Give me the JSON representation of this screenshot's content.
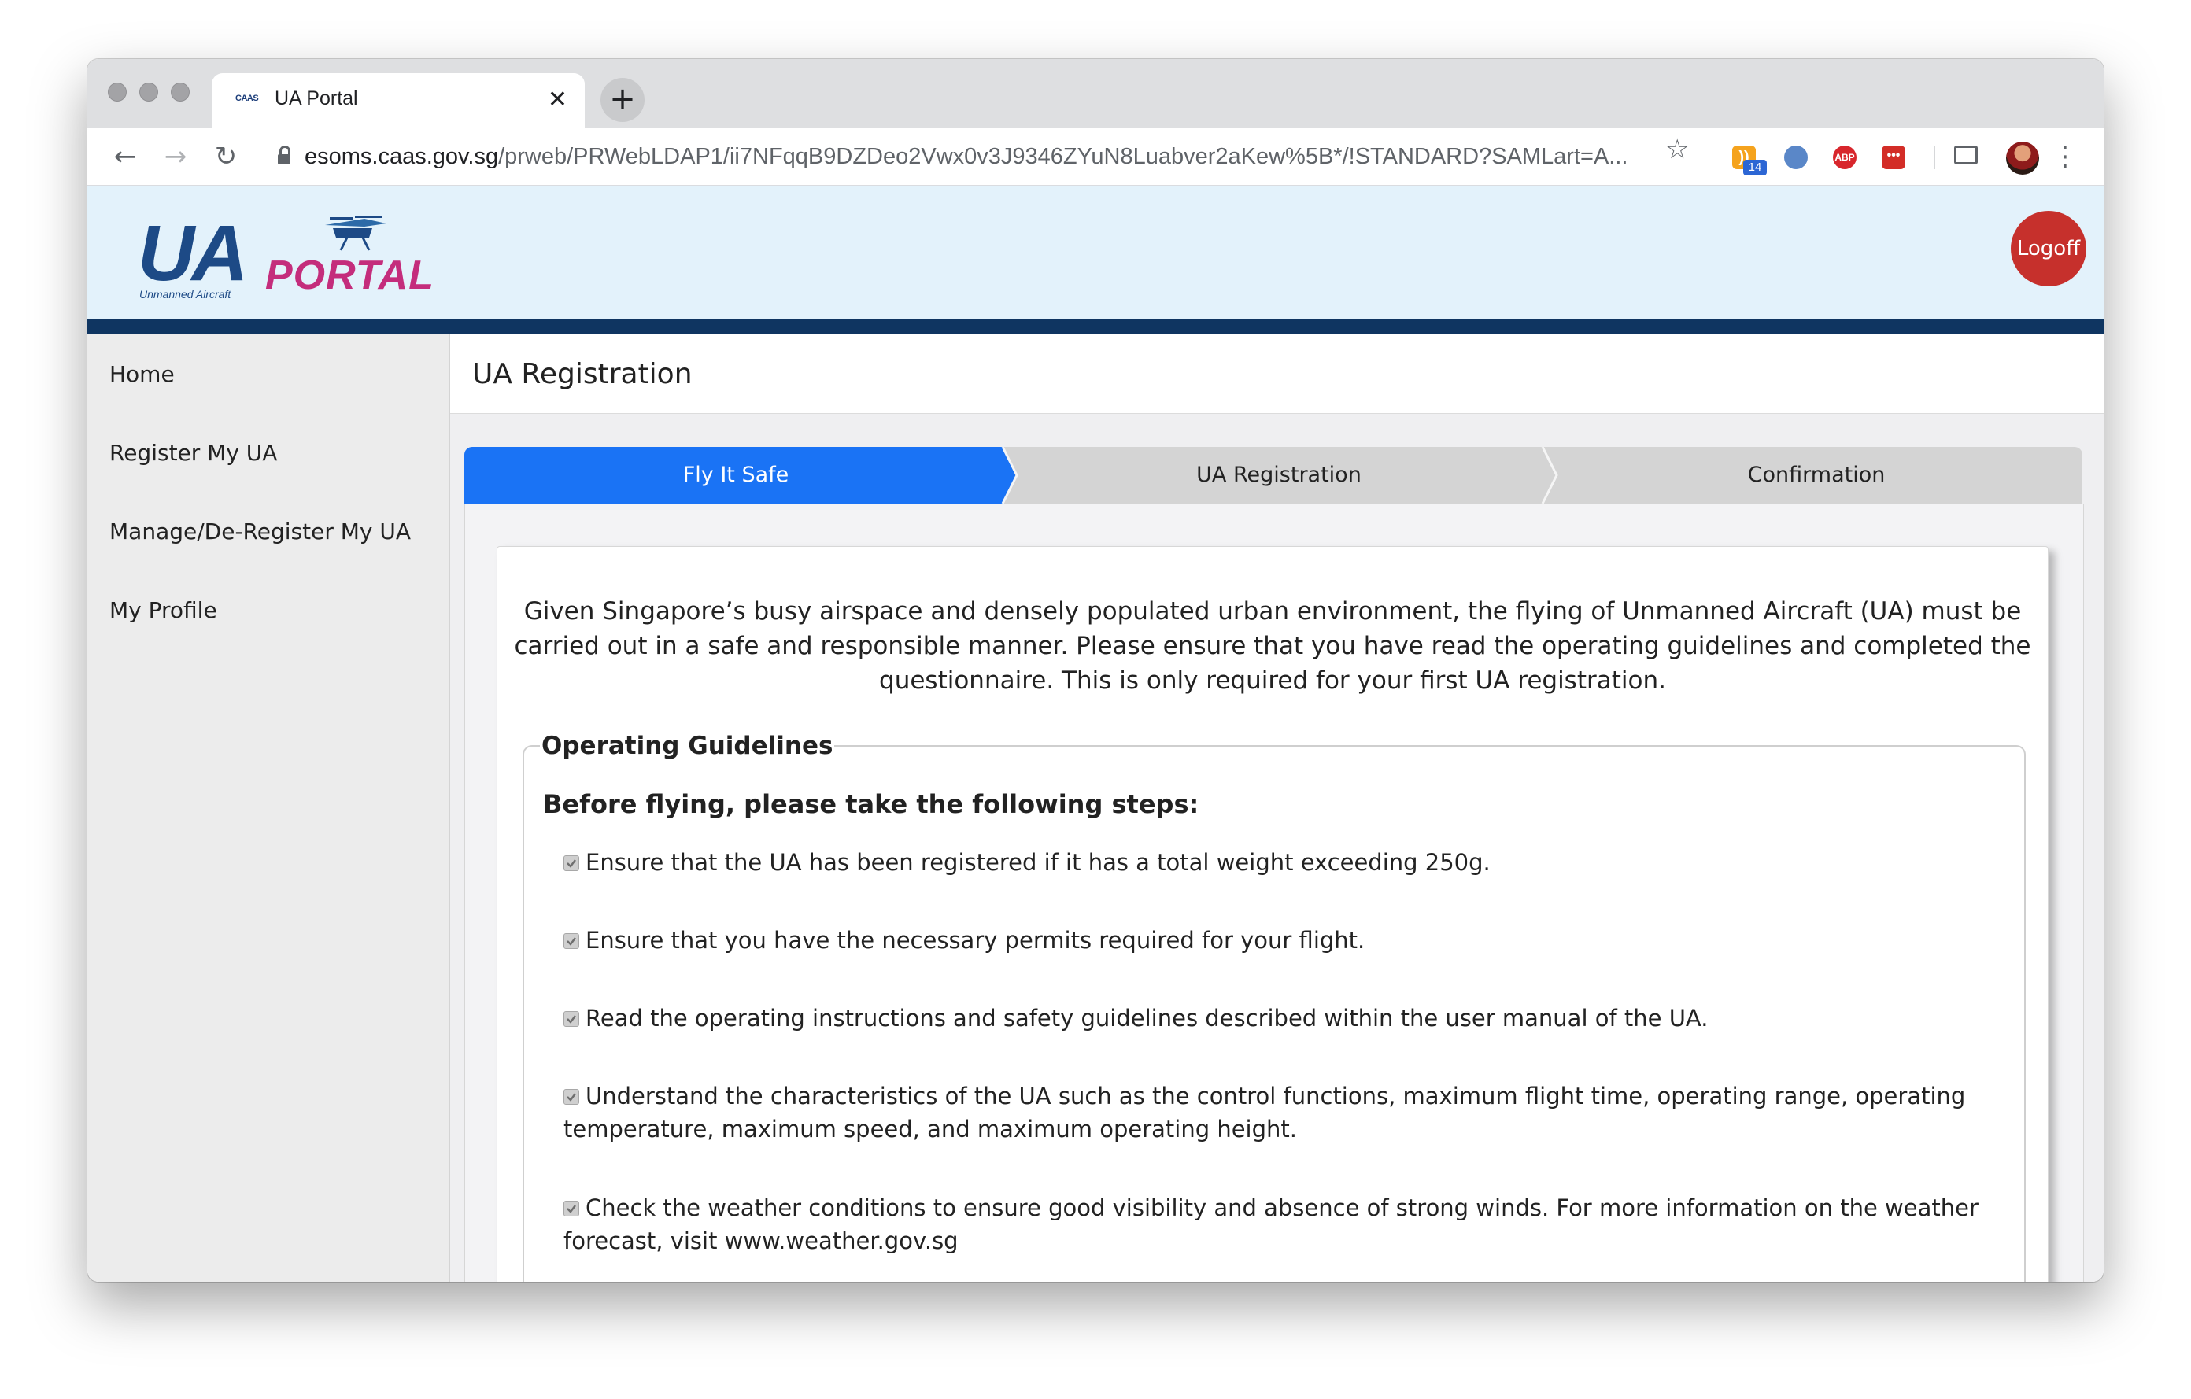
{
  "browser": {
    "tab": {
      "title": "UA Portal",
      "favicon": "CAAS",
      "close": "✕"
    },
    "new_tab": "+",
    "url_host": "esoms.caas.gov.sg",
    "url_path": "/prweb/PRWebLDAP1/ii7NFqqB9DZDeo2Vwx0v3J9346ZYuN8Luabver2aKew%5B*/!STANDARD?SAMLart=A...",
    "extensions": {
      "rss_badge": "14",
      "abp_label": "ABP",
      "lastpass_label": "•••"
    }
  },
  "header": {
    "logo": {
      "main": "UA",
      "accent": "PORTAL",
      "sub": "Unmanned Aircraft"
    },
    "logoff_label": "Logoff",
    "colors": {
      "header_bg": "#e3f2fb",
      "header_bar": "#0f3561",
      "logoff": "#c6302c",
      "active_step": "#1a73f5"
    }
  },
  "sidebar": {
    "items": [
      {
        "label": "Home"
      },
      {
        "label": "Register My UA"
      },
      {
        "label": "Manage/De-Register My UA"
      },
      {
        "label": "My Profile"
      }
    ]
  },
  "main": {
    "title": "UA Registration",
    "steps": [
      {
        "label": "Fly It Safe",
        "active": true
      },
      {
        "label": "UA Registration",
        "active": false
      },
      {
        "label": "Confirmation",
        "active": false
      }
    ],
    "intro": "Given Singapore’s busy airspace and densely populated urban environment, the flying of Unmanned Aircraft (UA) must be carried out in a safe and responsible manner. Please ensure that you have read the operating guidelines and completed the questionnaire. This is only required for your first UA registration.",
    "guidelines": {
      "legend": "Operating Guidelines",
      "heading": "Before flying, please take the following steps:",
      "items": [
        {
          "text": "Ensure that the UA has been registered if it has a total weight exceeding 250g.",
          "checked": true
        },
        {
          "text": "Ensure that you have the necessary permits required for your flight.",
          "checked": true
        },
        {
          "text": "Read the operating instructions and safety guidelines described within the user manual of the UA.",
          "checked": true
        },
        {
          "text": "Understand the characteristics of the UA such as the control functions, maximum flight time, operating range, operating temperature, maximum speed, and maximum operating height.",
          "checked": true
        },
        {
          "text": "Check the weather conditions to ensure good visibility and absence of strong winds. For more information on the weather forecast, visit www.weather.gov.sg",
          "checked": true
        }
      ]
    }
  }
}
